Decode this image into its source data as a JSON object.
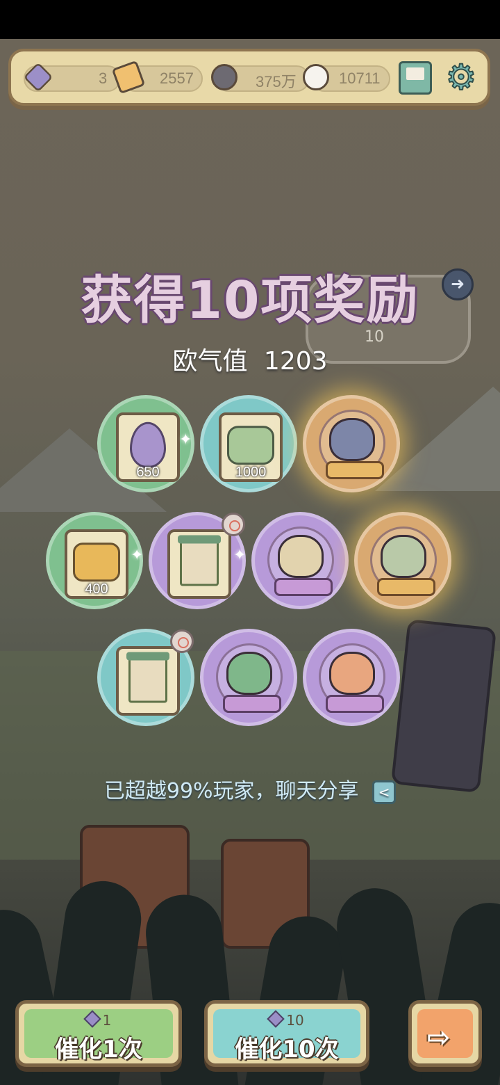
{
  "topbar": {
    "gem_count": "3",
    "ticket_count": "2557",
    "soul_count": "375万",
    "spirit_count": "10711"
  },
  "reward_panel": {
    "title": "获得10项奖励",
    "luck_label": "欧气值",
    "luck_value": "1203",
    "ghost_count": "10",
    "items": [
      {
        "kind": "egg",
        "count": "650",
        "color": "green"
      },
      {
        "kind": "stone",
        "count": "1000",
        "color": "cyan"
      },
      {
        "kind": "gold-creature",
        "count": "",
        "color": "gold"
      },
      {
        "kind": "ore",
        "count": "400",
        "color": "green"
      },
      {
        "kind": "scroll",
        "count": "",
        "color": "purple"
      },
      {
        "kind": "purple-creature",
        "count": "",
        "color": "purple"
      },
      {
        "kind": "gold-creature",
        "count": "",
        "color": "gold"
      },
      {
        "kind": "scroll",
        "count": "",
        "color": "cyan"
      },
      {
        "kind": "purple-creature",
        "count": "",
        "color": "purple"
      },
      {
        "kind": "purple-creature",
        "count": "",
        "color": "purple"
      }
    ],
    "share_text": "已超越99%玩家，聊天分享"
  },
  "buttons": {
    "once_cost": "1",
    "once_label": "催化1次",
    "ten_cost": "10",
    "ten_label": "催化10次"
  },
  "icons": {
    "gem": "crystal-gem-icon",
    "ticket": "ticket-icon",
    "soul": "dark-ghost-icon",
    "spirit": "white-ghost-icon",
    "mail": "mail-icon",
    "settings": "gear-icon",
    "share": "share-icon",
    "next": "arrow-right-icon"
  },
  "colors": {
    "green": "#7fc08f",
    "cyan": "#7fc8c7",
    "purple": "#b79ad9",
    "gold": "#d9a971"
  }
}
